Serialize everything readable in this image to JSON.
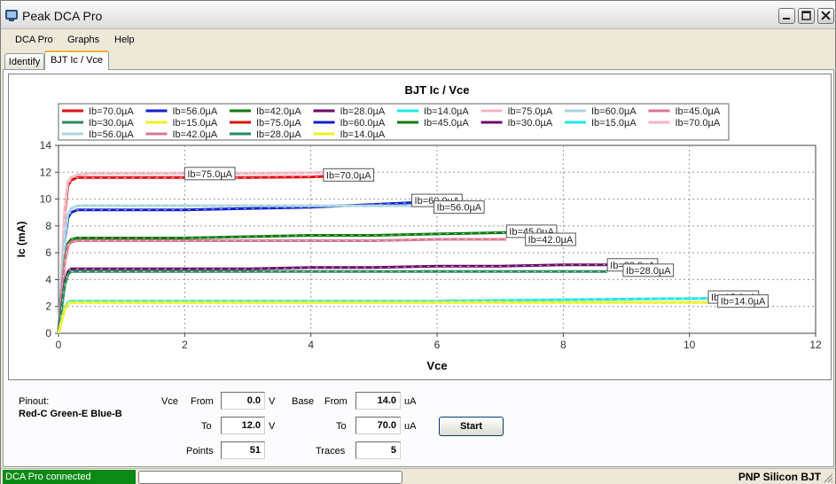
{
  "window": {
    "title": "Peak DCA Pro"
  },
  "menu": [
    "DCA Pro",
    "Graphs",
    "Help"
  ],
  "tabs": [
    {
      "label": "Identify",
      "active": false
    },
    {
      "label": "BJT Ic / Vce",
      "active": true
    }
  ],
  "chart_data": {
    "type": "line",
    "title": "BJT Ic / Vce",
    "xlabel": "Vce",
    "ylabel": "Ic (mA)",
    "xlim": [
      0,
      12
    ],
    "ylim": [
      0,
      14
    ],
    "xticks": [
      0,
      2,
      4,
      6,
      8,
      10,
      12
    ],
    "yticks": [
      0,
      2,
      4,
      6,
      8,
      10,
      12,
      14
    ],
    "grid": true,
    "legend_position": "top",
    "legend": [
      {
        "name": "Ib=70.0µA",
        "color": "#e01010"
      },
      {
        "name": "Ib=56.0µA",
        "color": "#1020d0"
      },
      {
        "name": "Ib=42.0µA",
        "color": "#0a7a10"
      },
      {
        "name": "Ib=28.0µA",
        "color": "#6a0a6a"
      },
      {
        "name": "Ib=14.0µA",
        "color": "#20e8e8"
      },
      {
        "name": "Ib=75.0µA",
        "color": "#f4b4c0"
      },
      {
        "name": "Ib=60.0µA",
        "color": "#a8d4e0"
      },
      {
        "name": "Ib=45.0µA",
        "color": "#d87890"
      },
      {
        "name": "Ib=30.0µA",
        "color": "#2a8a5a"
      },
      {
        "name": "Ib=15.0µA",
        "color": "#f0f020"
      },
      {
        "name": "Ib=75.0µA",
        "color": "#e01010"
      },
      {
        "name": "Ib=60.0µA",
        "color": "#1020d0"
      },
      {
        "name": "Ib=45.0µA",
        "color": "#0a7a10"
      },
      {
        "name": "Ib=30.0µA",
        "color": "#6a0a6a"
      },
      {
        "name": "Ib=15.0µA",
        "color": "#20e8e8"
      },
      {
        "name": "Ib=70.0µA",
        "color": "#f4b4c0"
      },
      {
        "name": "Ib=56.0µA",
        "color": "#a8d4e0"
      },
      {
        "name": "Ib=42.0µA",
        "color": "#d87890"
      },
      {
        "name": "Ib=28.0µA",
        "color": "#2a8a5a"
      },
      {
        "name": "Ib=14.0µA",
        "color": "#f0f020"
      }
    ],
    "series": [
      {
        "name": "Ib=75.0µA",
        "color": "#e01010",
        "x": [
          0,
          0.05,
          0.1,
          0.15,
          0.2,
          0.3,
          0.5,
          1,
          2,
          3,
          4,
          4.3
        ],
        "y": [
          0,
          4,
          9,
          11,
          11.4,
          11.6,
          11.6,
          11.6,
          11.6,
          11.6,
          11.65,
          11.7
        ],
        "end_label": "Ib=75.0µA",
        "label_at": [
          2,
          11.9
        ]
      },
      {
        "name": "Ib=70.0µA",
        "color": "#f4b4c0",
        "x": [
          0,
          0.05,
          0.1,
          0.15,
          0.2,
          0.3,
          0.5,
          1,
          2,
          3,
          4,
          4.3
        ],
        "y": [
          0,
          4.2,
          9.3,
          11.3,
          11.6,
          11.8,
          11.9,
          11.9,
          11.9,
          11.9,
          11.95,
          12.0
        ],
        "end_label": "Ib=70.0µA",
        "label_at": [
          4.2,
          11.8
        ]
      },
      {
        "name": "Ib=60.0µA",
        "color": "#1020d0",
        "x": [
          0,
          0.05,
          0.1,
          0.15,
          0.2,
          0.3,
          0.5,
          1,
          2,
          3,
          4,
          5,
          5.9
        ],
        "y": [
          0,
          3.5,
          7,
          8.6,
          9.0,
          9.2,
          9.2,
          9.2,
          9.2,
          9.3,
          9.4,
          9.6,
          9.8
        ],
        "end_label": "Ib=60.0µA",
        "label_at": [
          5.6,
          9.9
        ]
      },
      {
        "name": "Ib=56.0µA",
        "color": "#a8d4e0",
        "x": [
          0,
          0.05,
          0.1,
          0.15,
          0.2,
          0.3,
          0.5,
          1,
          2,
          3,
          4,
          5,
          5.9
        ],
        "y": [
          0,
          3.6,
          7.2,
          8.9,
          9.3,
          9.5,
          9.5,
          9.5,
          9.5,
          9.5,
          9.5,
          9.5,
          9.5
        ],
        "end_label": "Ib=56.0µA",
        "label_at": [
          5.95,
          9.4
        ]
      },
      {
        "name": "Ib=45.0µA",
        "color": "#0a7a10",
        "x": [
          0,
          0.05,
          0.1,
          0.15,
          0.2,
          0.3,
          0.5,
          1,
          2,
          3,
          4,
          5,
          6,
          7.1
        ],
        "y": [
          0,
          2.8,
          5.5,
          6.7,
          7.0,
          7.1,
          7.1,
          7.1,
          7.1,
          7.2,
          7.3,
          7.3,
          7.4,
          7.5
        ],
        "end_label": "Ib=45.0µA",
        "label_at": [
          7.1,
          7.6
        ]
      },
      {
        "name": "Ib=42.0µA",
        "color": "#d87890",
        "x": [
          0,
          0.05,
          0.1,
          0.15,
          0.2,
          0.3,
          0.5,
          1,
          2,
          3,
          4,
          5,
          6,
          7.1
        ],
        "y": [
          0,
          2.7,
          5.3,
          6.5,
          6.8,
          6.9,
          6.9,
          6.9,
          6.9,
          6.9,
          6.9,
          6.9,
          7.0,
          7.0
        ],
        "end_label": "Ib=42.0µA",
        "label_at": [
          7.4,
          7.0
        ]
      },
      {
        "name": "Ib=30.0µA",
        "color": "#6a0a6a",
        "x": [
          0,
          0.05,
          0.1,
          0.15,
          0.2,
          0.3,
          0.5,
          1,
          2,
          3,
          4,
          5,
          6,
          7,
          8,
          8.7
        ],
        "y": [
          0,
          2.0,
          3.8,
          4.6,
          4.8,
          4.8,
          4.8,
          4.8,
          4.8,
          4.8,
          4.9,
          4.9,
          5.0,
          5.0,
          5.1,
          5.1
        ],
        "end_label": "Ib=30.0µA",
        "label_at": [
          8.7,
          5.1
        ]
      },
      {
        "name": "Ib=28.0µA",
        "color": "#2a8a5a",
        "x": [
          0,
          0.05,
          0.1,
          0.15,
          0.2,
          0.3,
          0.5,
          1,
          2,
          3,
          4,
          5,
          6,
          7,
          8,
          8.7
        ],
        "y": [
          0,
          1.9,
          3.6,
          4.4,
          4.6,
          4.6,
          4.6,
          4.6,
          4.6,
          4.6,
          4.6,
          4.6,
          4.6,
          4.6,
          4.6,
          4.6
        ],
        "end_label": "Ib=28.0µA",
        "label_at": [
          8.95,
          4.7
        ]
      },
      {
        "name": "Ib=15.0µA",
        "color": "#20e8e8",
        "x": [
          0,
          0.05,
          0.1,
          0.15,
          0.2,
          0.3,
          0.5,
          1,
          2,
          4,
          6,
          8,
          10.3
        ],
        "y": [
          0,
          1.0,
          1.9,
          2.3,
          2.4,
          2.4,
          2.4,
          2.4,
          2.4,
          2.4,
          2.4,
          2.5,
          2.6
        ],
        "end_label": "Ib=15.0µA",
        "label_at": [
          10.3,
          2.7
        ]
      },
      {
        "name": "Ib=14.0µA",
        "color": "#f0f020",
        "x": [
          0,
          0.05,
          0.1,
          0.15,
          0.2,
          0.3,
          0.5,
          1,
          2,
          4,
          6,
          8,
          10.3
        ],
        "y": [
          0,
          0.95,
          1.8,
          2.2,
          2.3,
          2.3,
          2.3,
          2.3,
          2.3,
          2.3,
          2.3,
          2.3,
          2.3
        ],
        "end_label": "Ib=14.0µA",
        "label_at": [
          10.45,
          2.4
        ]
      }
    ]
  },
  "pinout": {
    "label": "Pinout:",
    "value": "Red-C Green-E Blue-B"
  },
  "controls": {
    "vce_label": "Vce",
    "from_label": "From",
    "to_label": "To",
    "vce_from": "0.0",
    "vce_to": "12.0",
    "vce_unit": "V",
    "base_label": "Base",
    "base_from": "14.0",
    "base_to": "70.0",
    "base_unit": "uA",
    "points_label": "Points",
    "points": "51",
    "traces_label": "Traces",
    "traces": "5",
    "start_label": "Start"
  },
  "status": {
    "connection": "DCA Pro connected",
    "device": "PNP Silicon BJT"
  }
}
